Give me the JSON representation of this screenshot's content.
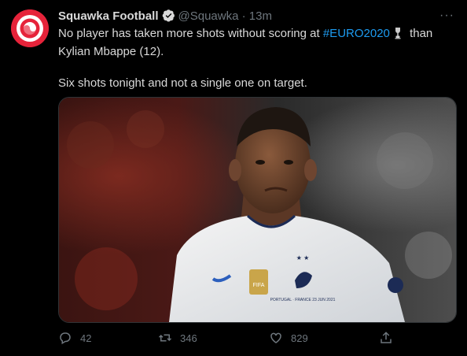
{
  "tweet": {
    "author_name": "Squawka Football",
    "handle": "@Squawka",
    "dot": "·",
    "time": "13m",
    "more_label": "···",
    "text_before": "No player has taken more shots without scoring at ",
    "hashtag": "#EURO2020",
    "text_after": " than Kylian Mbappe (12).",
    "text_line2": "Six shots tonight and not a single one on target."
  },
  "media": {
    "shirt_date": "PORTUGAL · FRANCE 23 JUN 2021",
    "badge_text": "FIFA"
  },
  "actions": {
    "reply_count": "42",
    "retweet_count": "346",
    "like_count": "829"
  },
  "colors": {
    "brand_red": "#e6233a",
    "link_blue": "#1d9bf0",
    "muted": "#6e767d",
    "background": "#000000"
  },
  "icons": [
    "squawka-logo-icon",
    "verified-icon",
    "more-icon",
    "trophy-icon",
    "reply-icon",
    "retweet-icon",
    "like-icon",
    "share-icon"
  ]
}
